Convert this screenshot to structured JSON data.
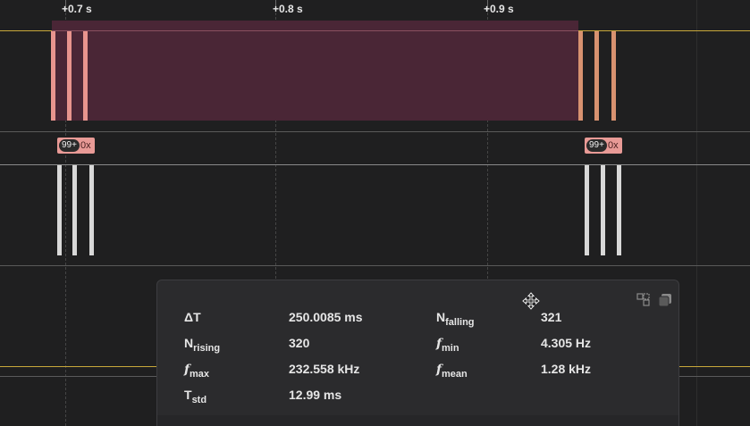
{
  "ruler": {
    "labels": [
      "+0.7 s",
      "+0.8 s",
      "+0.9 s"
    ]
  },
  "channels": {
    "ch1": {
      "badge_count": "99+",
      "badge_hex": "0x",
      "badge2_count": "99+",
      "badge2_hex": "0x"
    }
  },
  "measurement": {
    "rows": [
      {
        "name": "ΔT",
        "value": "250.0085 ms"
      },
      {
        "name": "N",
        "sub": "rising",
        "value": "320"
      },
      {
        "name": "f",
        "sub": "max",
        "value": "232.558 kHz"
      },
      {
        "name": "T",
        "sub": "std",
        "value": "12.99 ms"
      },
      {
        "name": "N",
        "sub": "falling",
        "value": "321"
      },
      {
        "name": "f",
        "sub": "min",
        "value": "4.305 Hz"
      },
      {
        "name": "f",
        "sub": "mean",
        "value": "1.28 kHz"
      }
    ],
    "icons": [
      "tile-icon",
      "copy-icon"
    ]
  },
  "colors": {
    "background": "#1f1f20",
    "selection": "#4a2636",
    "pulse_salmon": "#e8948e",
    "pulse_orange": "#d89270",
    "pulse_white": "#d8d8d8",
    "trace_yellow": "#c8a83a",
    "badge": "#e89a96"
  }
}
